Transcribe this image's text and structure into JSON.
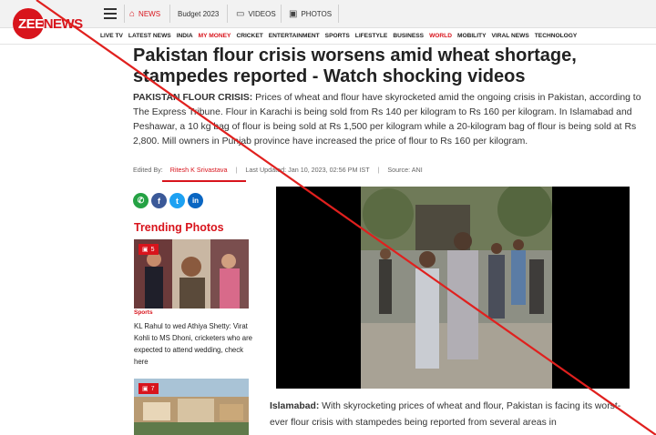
{
  "header": {
    "logo": "ZEE NEWS",
    "nav": [
      {
        "icon": "home-icon",
        "label": "NEWS"
      },
      {
        "label": "Budget 2023"
      },
      {
        "icon": "tv-icon",
        "label": "VIDEOS"
      },
      {
        "icon": "photo-icon",
        "label": "PHOTOS"
      }
    ],
    "sections": [
      "LIVE TV",
      "LATEST NEWS",
      "INDIA",
      "MY MONEY",
      "CRICKET",
      "ENTERTAINMENT",
      "SPORTS",
      "LIFESTYLE",
      "BUSINESS",
      "WORLD",
      "MOBILITY",
      "VIRAL NEWS",
      "TECHNOLOGY"
    ]
  },
  "article": {
    "headline": "Pakistan flour crisis worsens amid wheat shortage, stampedes reported - Watch shocking videos",
    "intro_lead": "PAKISTAN FLOUR CRISIS:",
    "intro_body": " Prices of wheat and flour have skyrocketed amid the ongoing crisis in Pakistan, according to The Express Tribune. Flour in Karachi is being sold from Rs 140 per kilogram to Rs 160 per kilogram. In Islamabad and Peshawar, a 10 kg bag of flour is being sold at Rs 1,500 per kilogram while a 20-kilogram bag of flour is being sold at Rs 2,800. Mill owners in Punjab province have increased the price of flour to Rs 160 per kilogram.",
    "byline": {
      "edited_label": "Edited By:",
      "author": "Ritesh K Srivastava",
      "updated": "Last Updated: Jan 10, 2023, 02:56 PM IST",
      "source": "Source: ANI"
    },
    "lead_place": "Islamabad:",
    "lead_body": " With skyrocketing prices of wheat and flour, Pakistan is facing its worst-ever flour crisis with stampedes being reported from several areas in"
  },
  "share_icons": [
    "whatsapp-icon",
    "facebook-icon",
    "twitter-icon",
    "linkedin-icon"
  ],
  "trending": {
    "title": "Trending Photos",
    "cards": [
      {
        "count": "5",
        "category": "Sports",
        "text": "KL Rahul to wed Athiya Shetty: Virat Kohli to MS Dhoni, cricketers who are expected to attend wedding, check here"
      },
      {
        "count": "7"
      }
    ]
  },
  "colors": {
    "brand": "#d8141c",
    "overlay": "#e0201e"
  }
}
